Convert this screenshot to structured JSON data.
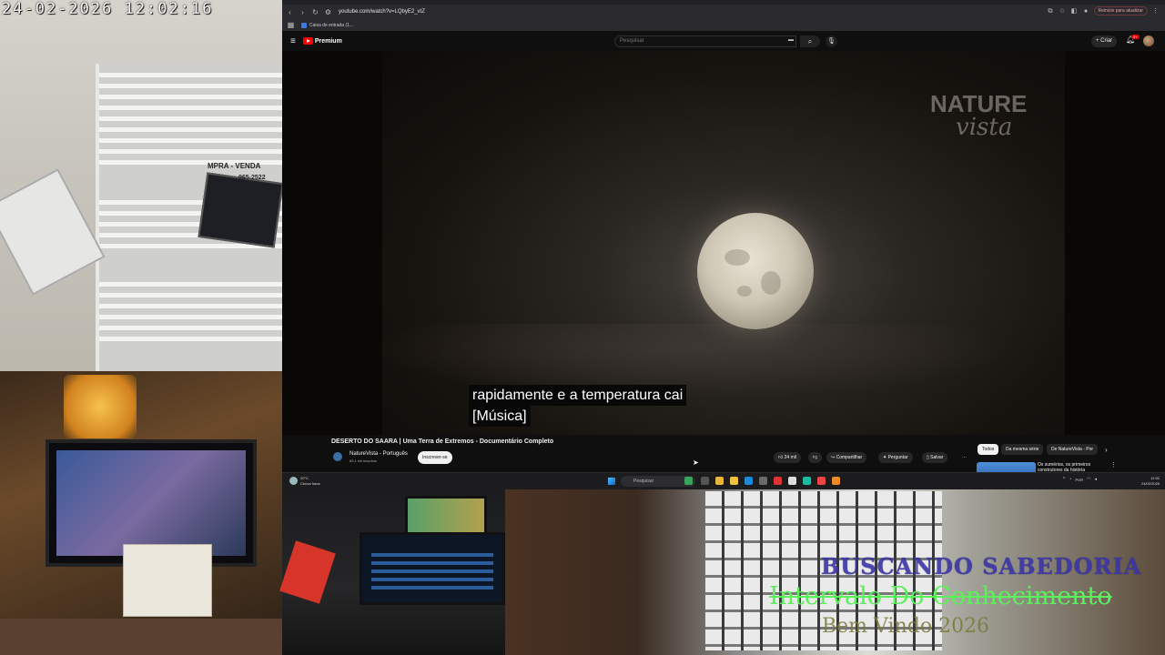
{
  "camera_overlay": {
    "timestamp": "24-02-2026  12:02:16",
    "sign_text": "MPRA - VENDA",
    "sign_phone": "965-2522",
    "banner_lines": [
      "BUSCANDO SABEDORIA",
      "Intervalo Do Conhecimento",
      "Bem Vindo 2026"
    ]
  },
  "browser": {
    "url": "youtube.com/watch?v=LQbyE2_vtZ",
    "bookmark_label": "Caixa de entrada (1...",
    "update_button": "Reinicie para atualizar"
  },
  "youtube": {
    "logo_text": "Premium",
    "search_placeholder": "Pesquisar",
    "create_label": "+ Criar",
    "notifications_badge": "9+",
    "watermark_line1": "NATURE",
    "watermark_line2": "vista",
    "captions": [
      "rapidamente e a temperatura cai",
      "[Música]"
    ],
    "video_title": "DESERTO DO SAARA | Uma Terra de Extremos - Documentário Completo",
    "channel_name": "NatureVista - Português",
    "channel_subs": "69,1 mil inscritos",
    "subscribe_label": "Inscrever-se",
    "actions": {
      "likes": "24 mil",
      "share": "Compartilhar",
      "ask": "Perguntar",
      "save": "Salvar",
      "more": "···"
    },
    "chips": [
      "Todos",
      "Da mesma série",
      "De NatureVista - Por"
    ],
    "reco_title": "Os sumérios, os primeiros construtores da história"
  },
  "taskbar": {
    "weather_temp": "20°C",
    "weather_desc": "Chuva fraca",
    "search_label": "Pesquisar",
    "lang": "POR",
    "clock_time": "12:02",
    "clock_date": "24/02/2026"
  },
  "colors": {
    "yt_red": "#ff0000",
    "banner_green": "#5cf05c",
    "banner_blue": "#3a35a8"
  },
  "icons": [
    "menu-icon",
    "search-icon",
    "keyboard-icon",
    "mic-icon",
    "bell-icon",
    "like-icon",
    "dislike-icon",
    "share-icon",
    "save-icon",
    "chevron-right-icon",
    "windows-start-icon"
  ]
}
